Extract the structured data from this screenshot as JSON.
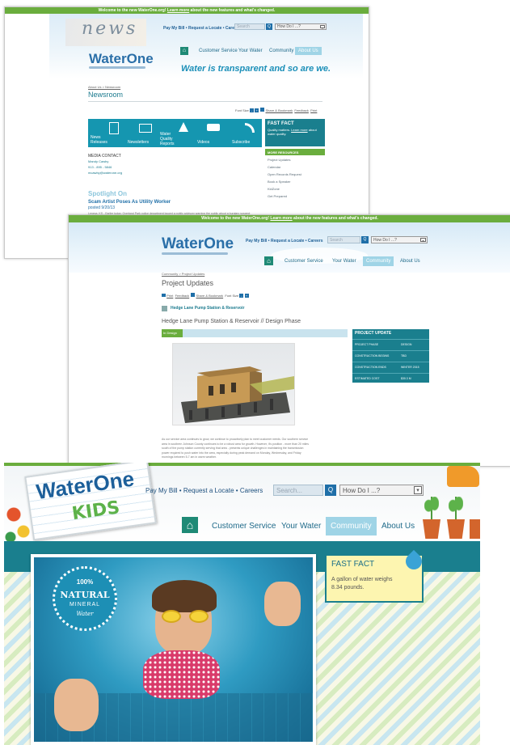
{
  "shot1": {
    "welcome": {
      "pre": "Welcome to the new WaterOne.org!",
      "link": "Learn more",
      "post": "about the new features and what's changed."
    },
    "header_art_text": "news",
    "logo": "WaterOne",
    "util": {
      "pay": "Pay My Bill",
      "locate": "Request a Locate",
      "careers": "Careers",
      "sep": "•"
    },
    "search_placeholder": "Search",
    "search_go": "Q",
    "howdoi": "How Do I ...?",
    "nav": {
      "customer": "Customer Service",
      "water": "Your Water",
      "community": "Community",
      "about": "About Us"
    },
    "tagline": "Water is transparent and so are we.",
    "breadcrumb": "About Us > Newsroom",
    "title": "Newsroom",
    "tools": {
      "font": "Font Size",
      "share": "Share & Bookmark",
      "feedback": "Feedback",
      "print": "Print"
    },
    "tiles": [
      "News Releases",
      "Newsletters",
      "Water Quality Reports",
      "Videos",
      "Subscribe"
    ],
    "fast_fact": {
      "title": "FAST FACT",
      "body": "Quality matters.",
      "link": "Learn more",
      "tail": "about water quality."
    },
    "more_resources": {
      "title": "MORE RESOURCES",
      "items": [
        "Project Updates",
        "Calendar",
        "Open Records Request",
        "Book a Speaker",
        "KidZone",
        "Get Prepared"
      ]
    },
    "media": {
      "title": "MEDIA CONTACT",
      "name": "Mandy Cawby",
      "phone": "913 - 895 - 5846",
      "email": "mcawby@waterone.org"
    },
    "spotlight": {
      "title": "Spotlight On",
      "headline": "Scam Artist Poses As Utility Worker",
      "date": "posted 9/20/13",
      "body": "Lenexa, KS - Earlier today, Overland Park police department issued a public advisory warning the public about a burglary suspect posing as a \"water company employee.\""
    }
  },
  "shot2": {
    "welcome": {
      "pre": "Welcome to the new WaterOne.org!",
      "link": "Learn more",
      "post": "about the new features and what's changed."
    },
    "logo": "WaterOne",
    "util": {
      "pay": "Pay My Bill",
      "locate": "Request a Locate",
      "careers": "Careers",
      "sep": "•"
    },
    "search_placeholder": "Search",
    "search_go": "Q",
    "howdoi": "How Do I ...?",
    "nav": {
      "customer": "Customer Service",
      "water": "Your Water",
      "community": "Community",
      "about": "About Us"
    },
    "breadcrumb": "Community > Project Updates",
    "title": "Project Updates",
    "tools": {
      "print": "Print",
      "feedback": "Feedback",
      "share": "Share & Bookmark",
      "font": "Font Size"
    },
    "project_link": "Hedge Lane Pump Station & Reservoir",
    "project_heading": "Hedge Lane Pump Station & Reservoir // Design Phase",
    "phase_badge": "In Design",
    "project_update": {
      "title": "PROJECT UPDATE",
      "rows": [
        {
          "label": "PROJECT PHASE",
          "value": "DESIGN"
        },
        {
          "label": "CONSTRUCTION BEGINS",
          "value": "TBD"
        },
        {
          "label": "CONSTRUCTION ENDS",
          "value": "WINTER 2015"
        },
        {
          "label": "ESTIMATED COST",
          "value": "$30.3 M"
        }
      ]
    },
    "body": [
      "As our service area continues to grow, we continue to proactively plan to meet customer needs. Our southern service",
      "area in southern Johnson County continues to be a robust area for growth. However, it's position - more than 20 miles",
      "south of the pump station currently serving that area - presents unique challenges in maintaining the transmission",
      "power required to push water into the area, especially during peak demand on Monday, Wednesday, and Friday",
      "mornings between 5-7 am in warm weather."
    ]
  },
  "shot3": {
    "logo_top": "WaterOne",
    "logo_kids": "KIDS",
    "util": {
      "pay": "Pay My Bill",
      "locate": "Request a Locate",
      "careers": "Careers",
      "sep": "•"
    },
    "search_placeholder": "Search...",
    "search_go": "Q",
    "howdoi": "How Do I ...?",
    "nav": {
      "customer": "Customer Service",
      "water": "Your Water",
      "community": "Community",
      "about": "About Us"
    },
    "seal": {
      "top": "100%",
      "mid1": "NATURAL",
      "mid2": "MINERAL",
      "bottom": "Water"
    },
    "fast_fact": {
      "title": "FAST FACT",
      "body": "A gallon of water weighs 8.34 pounds."
    }
  }
}
